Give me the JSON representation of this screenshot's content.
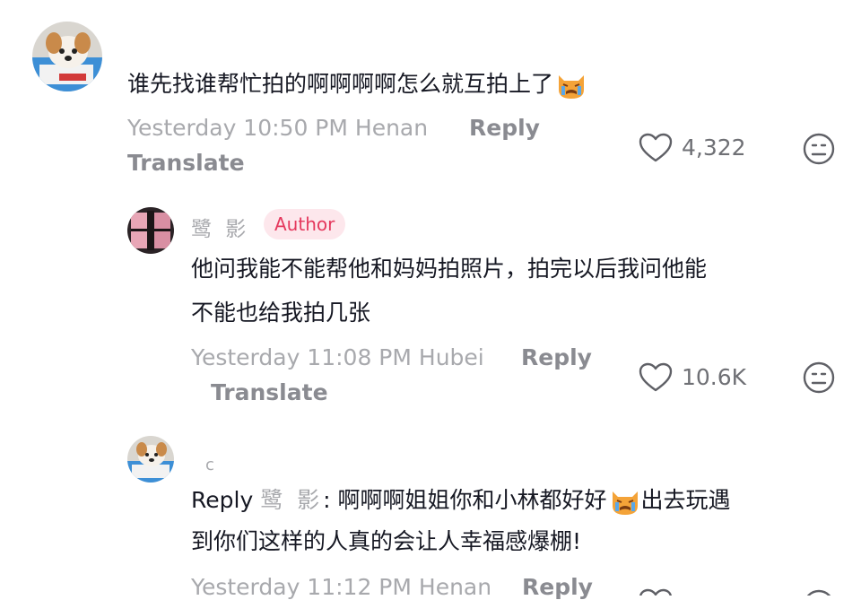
{
  "comments": [
    {
      "avatar": "corgi-dog-avatar",
      "text": "谁先找谁帮忙拍的啊啊啊啊怎么就互拍上了",
      "emoji": "crying-cat-icon",
      "meta": "Yesterday 10:50 PM Henan",
      "reply_label": "Reply",
      "translate_label": "Translate",
      "likes": "4,322"
    }
  ],
  "replies": [
    {
      "avatar": "pink-room-avatar",
      "username": "鹭 影",
      "badge": "Author",
      "text_line1": "他问我能不能帮他和妈妈拍照片，拍完以后我问他能",
      "text_line2": "不能也给我拍几张",
      "meta": "Yesterday 11:08 PM Hubei",
      "reply_label": "Reply",
      "translate_label": "Translate",
      "likes": "10.6K"
    },
    {
      "avatar": "corgi-dog-avatar",
      "username": "c",
      "reply_prefix": "Reply",
      "reply_to": "鹭 影",
      "text_line1": ": 啊啊啊姐姐你和小林都好好",
      "text_line1_tail": "出去玩遇",
      "emoji": "crying-cat-icon",
      "text_line2": "到你们这样的人真的会让人幸福感爆棚!",
      "meta": "Yesterday 11:12 PM Henan",
      "reply_label": "Reply"
    }
  ],
  "colors": {
    "text": "#161823",
    "meta": "#a8a9ad",
    "badge_bg": "#fde7ec",
    "badge_text": "#e5385d"
  },
  "icons": {
    "like": "heart-outline-icon",
    "dislike": "neutral-face-icon"
  }
}
